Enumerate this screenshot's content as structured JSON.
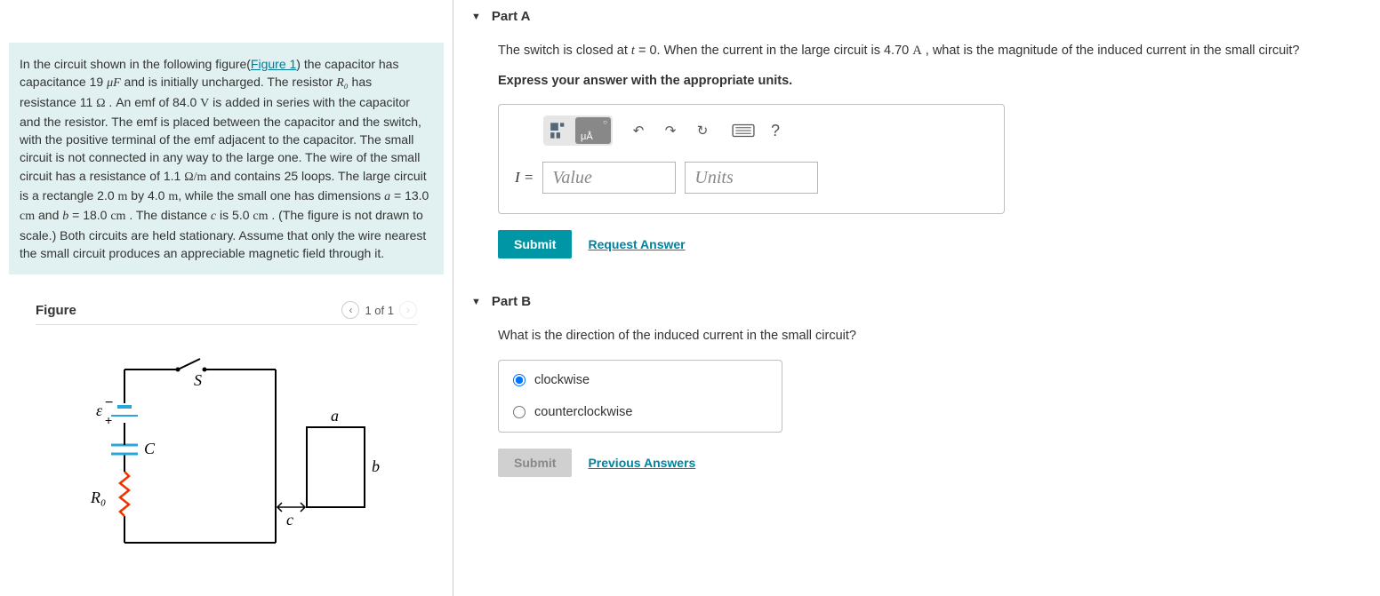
{
  "problem": {
    "text_parts": {
      "t1": "In the circuit shown in the following figure(",
      "fig_link": "Figure 1",
      "t2": ") the capacitor has capacitance 19 ",
      "cap_unit": "μF",
      "t3": " and is initially uncharged. The resistor ",
      "r0": "R₀",
      "t4": " has resistance 11 ",
      "ohm": "Ω",
      "t5": " . An emf of 84.0 ",
      "volt": "V",
      "t6": " is added in series with the capacitor and the resistor. The emf is placed between the capacitor and the switch, with the positive terminal of the emf adjacent to the capacitor. The small circuit is not connected in any way to the large one. The wire of the small circuit has a resistance of 1.1 ",
      "ohm_per_m": "Ω/m",
      "t7": " and contains 25 loops. The large circuit is a rectangle 2.0 ",
      "m": "m",
      "t8": " by 4.0 ",
      "t9": ", while the small one has dimensions ",
      "a_eq": "a",
      "t10": " = 13.0 ",
      "cm": "cm",
      "t11": " and ",
      "b_eq": "b",
      "t12": " = 18.0 ",
      "t13": " . The distance ",
      "c_eq": "c",
      "t14": " is 5.0 ",
      "t15": " . (The figure is not drawn to scale.) Both circuits are held stationary. Assume that only the wire nearest the small circuit produces an appreciable magnetic field through it."
    }
  },
  "figure": {
    "title": "Figure",
    "nav_prev": "‹",
    "nav_next": "›",
    "page": "1 of 1",
    "labels": {
      "S": "S",
      "eps": "ε",
      "plus": "+",
      "minus": "−",
      "C": "C",
      "R0": "R₀",
      "a": "a",
      "b": "b",
      "c": "c"
    }
  },
  "partA": {
    "header": "Part A",
    "question_p1": "The switch is closed at ",
    "t_eq": "t",
    "question_p2": " = 0. When the current in the large circuit is 4.70 ",
    "amp": "A",
    "question_p3": " , what is the magnitude of the induced current in the small circuit?",
    "instruction": "Express your answer with the appropriate units.",
    "label": "I =",
    "value_placeholder": "Value",
    "units_placeholder": "Units",
    "submit": "Submit",
    "request": "Request Answer",
    "toolbar": {
      "help": "?"
    }
  },
  "partB": {
    "header": "Part B",
    "question": "What is the direction of the induced current in the small circuit?",
    "opt1": "clockwise",
    "opt2": "counterclockwise",
    "submit": "Submit",
    "previous": "Previous Answers"
  }
}
